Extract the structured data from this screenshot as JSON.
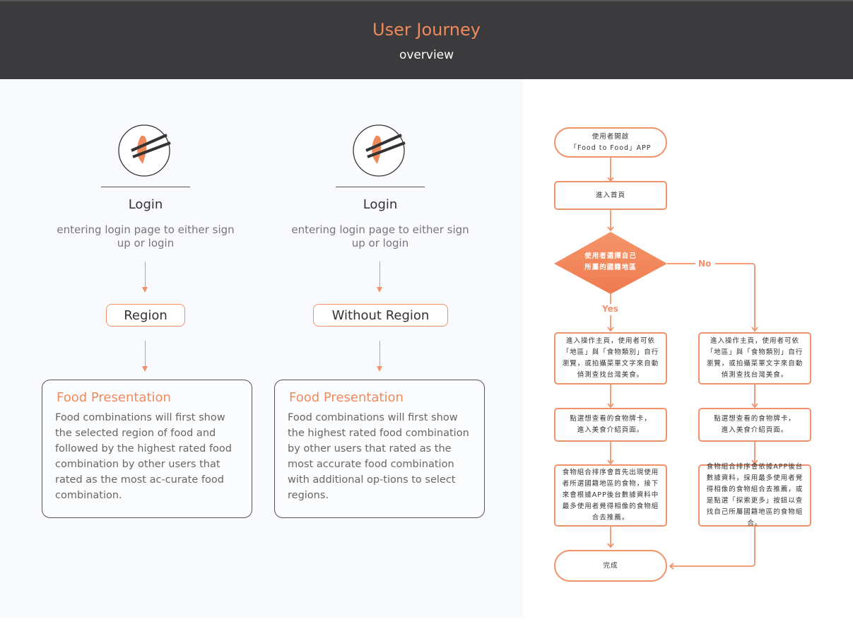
{
  "header": {
    "title": "User Journey",
    "subtitle": "overview"
  },
  "columns": [
    {
      "logo_icon": "taiwan-chopsticks-logo-icon",
      "heading": "Login",
      "description": "entering login page to either sign up or login",
      "branch_label": "Region",
      "card": {
        "title": "Food Presentation",
        "body": "Food combinations will first show the selected region of food and followed by the highest rated food combination by other users that rated as the most ac-curate food combination."
      }
    },
    {
      "logo_icon": "taiwan-chopsticks-logo-icon",
      "heading": "Login",
      "description": "entering login page to either sign up or login",
      "branch_label": "Without Region",
      "card": {
        "title": "Food Presentation",
        "body": "Food combinations will first show the highest rated food combination by other users that rated as the most accurate food combination with additional op-tions to select regions."
      }
    }
  ],
  "flowchart": {
    "start": "使用者開啟\n「Food to Food」APP",
    "home": "進入首頁",
    "decision": "使用者選擇自己\n所屬的國籍地區",
    "yes_label": "Yes",
    "no_label": "No",
    "yes_branch": [
      "進入操作主頁，使用者可依「地區」與「食物類別」自行瀏覽，或拍攝菜單文字來自動偵測查找台灣美食。",
      "點選想查看的食物牌卡，\n進入美食介紹頁面。",
      "食物組合排序會首先出現使用者所選國籍地區的食物，接下來會根據APP後台數據資料中最多使用者覺得相像的食物組合去推薦。"
    ],
    "no_branch": [
      "進入操作主頁，使用者可依「地區」與「食物類別」自行瀏覽，或拍攝菜單文字來自動偵測查找台灣美食。",
      "點選想查看的食物牌卡，\n進入美食介紹頁面。",
      "食物組合排序會依據APP後台數據資料，採用最多使用者覺得相像的食物組合去推薦，或是點選「探索更多」按鈕以查找自己所屬國籍地區的食物組合。"
    ],
    "end": "完成"
  },
  "colors": {
    "accent": "#f2926a",
    "header_bg": "#3b3a3c",
    "title": "#f08a5d"
  }
}
